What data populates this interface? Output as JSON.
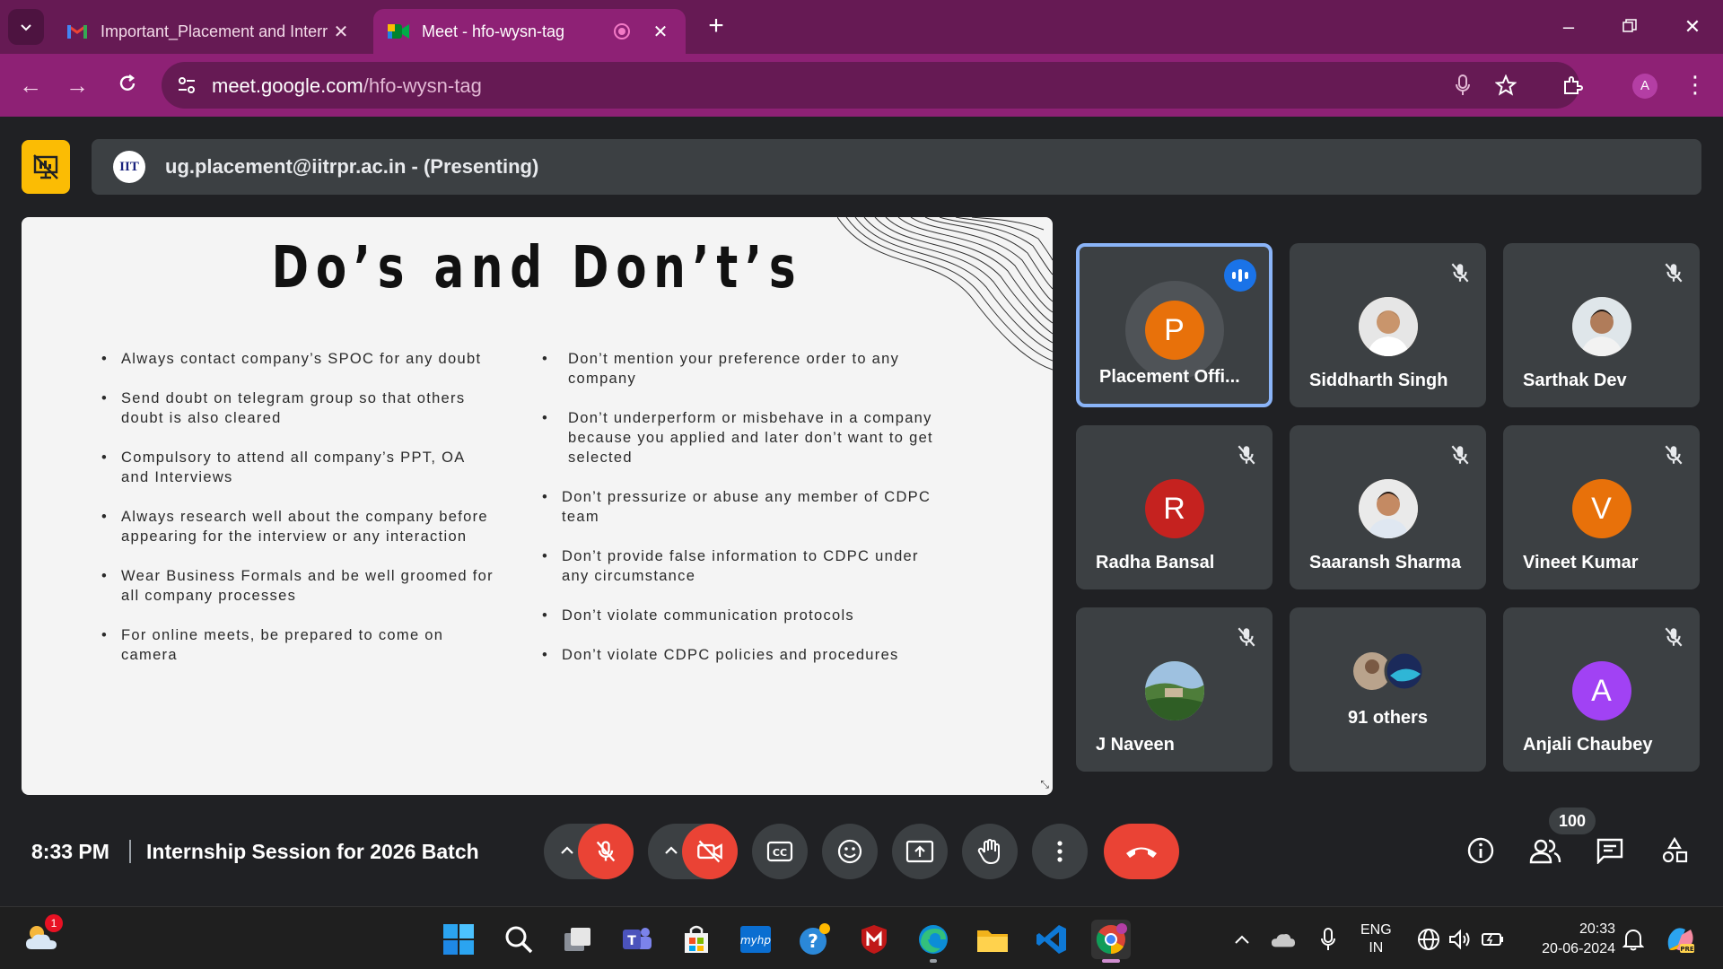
{
  "browser": {
    "tabs": [
      {
        "title": "Important_Placement and Interr",
        "active": false,
        "icon": "gmail-icon"
      },
      {
        "title": "Meet - hfo-wysn-tag",
        "active": true,
        "icon": "meet-icon",
        "recording": true
      }
    ],
    "url_host": "meet.google.com",
    "url_path": "/hfo-wysn-tag",
    "profile_initial": "A"
  },
  "meet": {
    "presenter_text": "ug.placement@iitrpr.ac.in - (Presenting)",
    "presenter_logo": "IIT",
    "slide": {
      "title": "Do’s and Don’t’s",
      "dos": [
        "Always contact company’s SPOC for any doubt",
        "Send doubt on telegram group so that others doubt is also cleared",
        "Compulsory to attend all company’s PPT, OA and Interviews",
        "Always research well about the company before appearing for the interview or any interaction",
        "Wear Business Formals and be well groomed for all company processes",
        "For online meets, be prepared to come on camera"
      ],
      "donts": [
        "Don’t mention your preference order to any company",
        "Don’t underperform or misbehave in a company because you applied and later don’t want to get selected",
        "Don’t pressurize or abuse any member of CDPC team",
        "Don’t provide false information to CDPC under any circumstance",
        "Don’t violate communication protocols",
        "Don’t violate CDPC policies and procedures"
      ]
    },
    "participants": [
      {
        "name": "Placement Offi...",
        "initial": "P",
        "color": "#e8710a",
        "speaking": true,
        "muted": false
      },
      {
        "name": "Siddharth Singh",
        "initial": "",
        "color": "#c9a27a",
        "speaking": false,
        "muted": true
      },
      {
        "name": "Sarthak Dev",
        "initial": "",
        "color": "#9e7b62",
        "speaking": false,
        "muted": true
      },
      {
        "name": "Radha Bansal",
        "initial": "R",
        "color": "#c5221f",
        "speaking": false,
        "muted": true
      },
      {
        "name": "Saaransh Sharma",
        "initial": "",
        "color": "#d7b89a",
        "speaking": false,
        "muted": true
      },
      {
        "name": "Vineet Kumar",
        "initial": "V",
        "color": "#e8710a",
        "speaking": false,
        "muted": true
      },
      {
        "name": "J Naveen",
        "initial": "",
        "color": "#4e7d3a",
        "speaking": false,
        "muted": true
      },
      {
        "name": "91 others",
        "initial": "",
        "color": "#3c4043",
        "speaking": false,
        "muted": false
      },
      {
        "name": "Anjali Chaubey",
        "initial": "A",
        "color": "#a142f4",
        "speaking": false,
        "muted": true
      }
    ],
    "time": "8:33 PM",
    "meeting_title": "Internship Session for 2026 Batch",
    "people_count": "100",
    "colors": {
      "end_call": "#ea4335",
      "accent_speaking": "#1a73e8"
    }
  },
  "taskbar": {
    "notification_count": "1",
    "lang_top": "ENG",
    "lang_bottom": "IN",
    "time": "20:33",
    "date": "20-06-2024",
    "apps": [
      "start-icon",
      "search-icon",
      "task-view-icon",
      "teams-icon",
      "store-icon",
      "myhp-icon",
      "help-icon",
      "mcafee-icon",
      "edge-icon",
      "file-explorer-icon",
      "vscode-icon",
      "chrome-icon"
    ]
  }
}
